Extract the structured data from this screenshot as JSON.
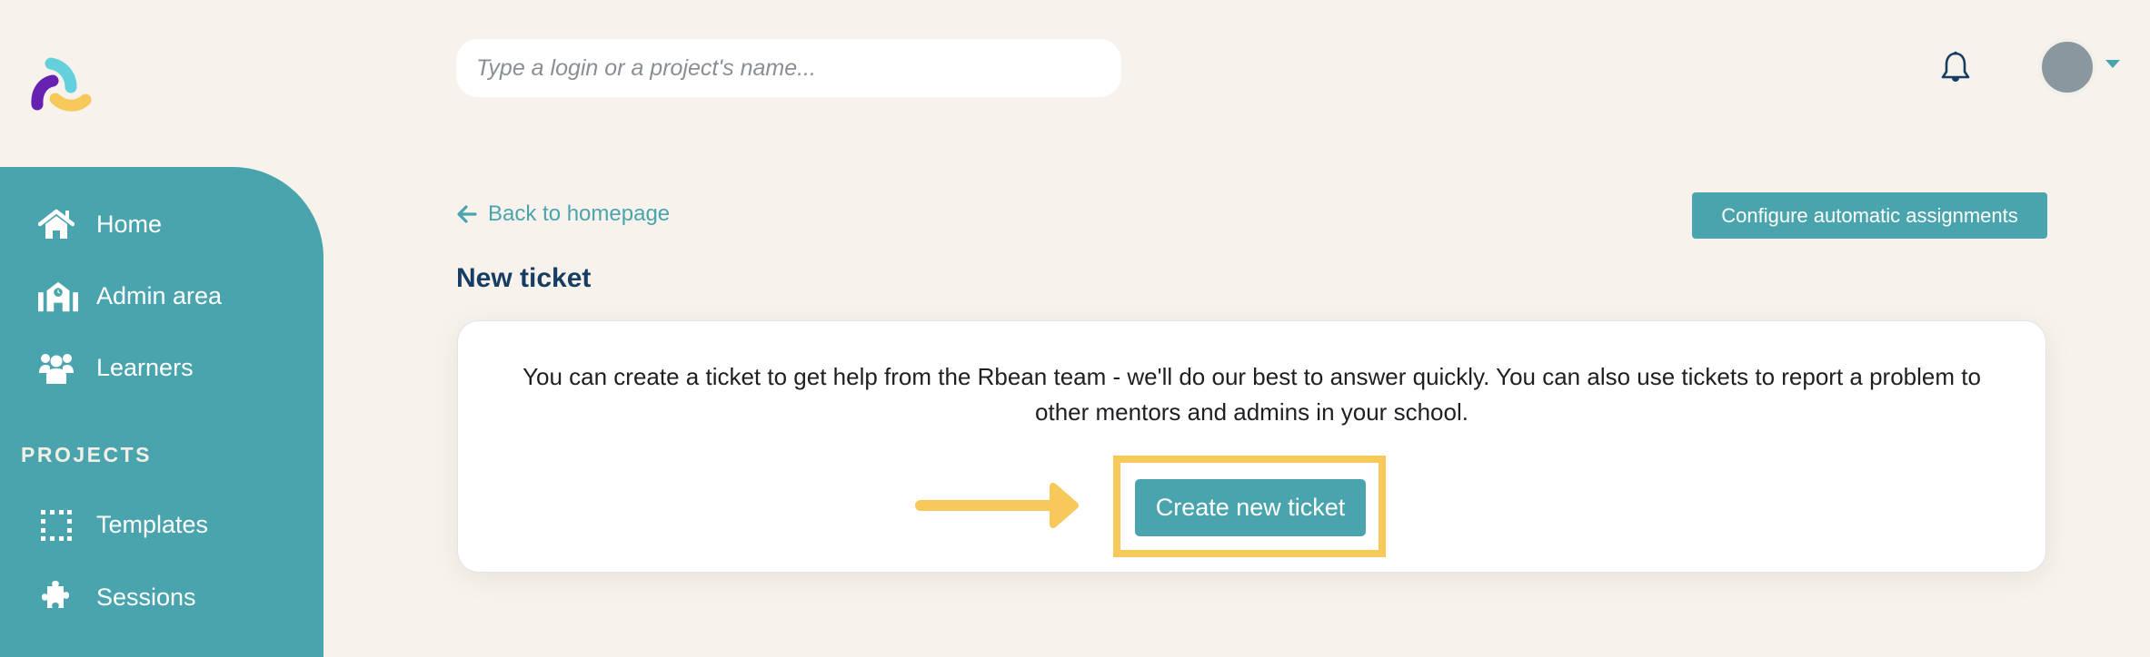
{
  "header": {
    "logo": "rbean-logo",
    "search": {
      "placeholder": "Type a login or a project's name...",
      "value": "",
      "icon": "search-icon"
    },
    "notifications_icon": "bell-icon",
    "avatar_icon": "user-avatar",
    "avatar_menu_icon": "caret-down-icon"
  },
  "sidebar": {
    "items": [
      {
        "label": "Home",
        "icon": "home-icon"
      },
      {
        "label": "Admin area",
        "icon": "school-icon"
      },
      {
        "label": "Learners",
        "icon": "users-icon"
      }
    ],
    "sections": [
      {
        "title": "PROJECTS",
        "items": [
          {
            "label": "Templates",
            "icon": "dotted-square-icon"
          },
          {
            "label": "Sessions",
            "icon": "puzzle-icon"
          }
        ]
      }
    ]
  },
  "main": {
    "back_link": {
      "label": "Back to homepage",
      "icon": "arrow-left-icon"
    },
    "title": "New ticket",
    "config_button": "Configure automatic assignments",
    "card": {
      "description": "You can create a ticket to get help from the Rbean team - we'll do our best to answer quickly. You can also use tickets to report a problem to other mentors and admins in your school.",
      "create_button": "Create new ticket"
    }
  },
  "annotation": {
    "highlight_color": "#f7c95a",
    "pointer": "arrow-right-annotation"
  },
  "colors": {
    "background": "#f7f3ec",
    "accent": "#4aa4ad",
    "title": "#173d63"
  }
}
